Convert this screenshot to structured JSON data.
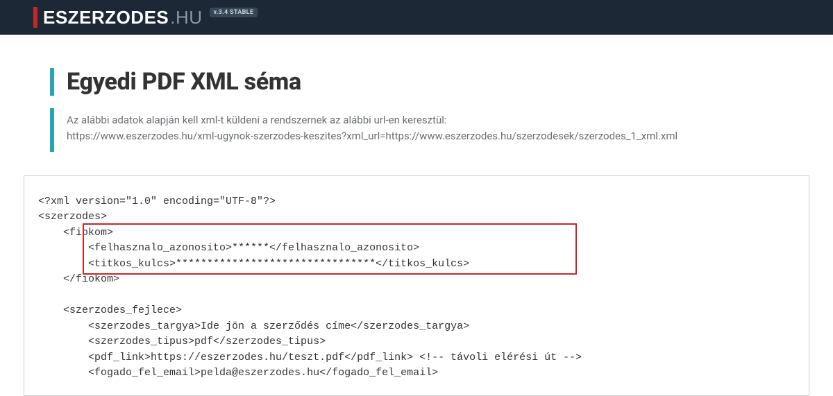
{
  "header": {
    "logo_main": "ESZERZODES",
    "logo_suffix": ".HU",
    "version_badge": "v.3.4 STABLE"
  },
  "title": "Egyedi PDF XML séma",
  "intro": {
    "line1": "Az alábbi adatok alapján kell xml-t küldeni a rendszernek az alábbi url-en keresztül:",
    "line2": "https://www.eszerzodes.hu/xml-ugynok-szerzodes-keszites?xml_url=https://www.eszerzodes.hu/szerzodesek/szerzodes_1_xml.xml"
  },
  "code": "<?xml version=\"1.0\" encoding=\"UTF-8\"?>\n<szerzodes>\n    <fiokom>\n        <felhasznalo_azonosito>******</felhasznalo_azonosito>\n        <titkos_kulcs>********************************</titkos_kulcs>\n    </fiokom>\n\n    <szerzodes_fejlece>\n        <szerzodes_targya>Ide jön a szerződés címe</szerzodes_targya>\n        <szerzodes_tipus>pdf</szerzodes_tipus>\n        <pdf_link>https://eszerzodes.hu/teszt.pdf</pdf_link> <!-- távoli elérési út -->\n        <fogado_fel_email>pelda@eszerzodes.hu</fogado_fel_email>"
}
